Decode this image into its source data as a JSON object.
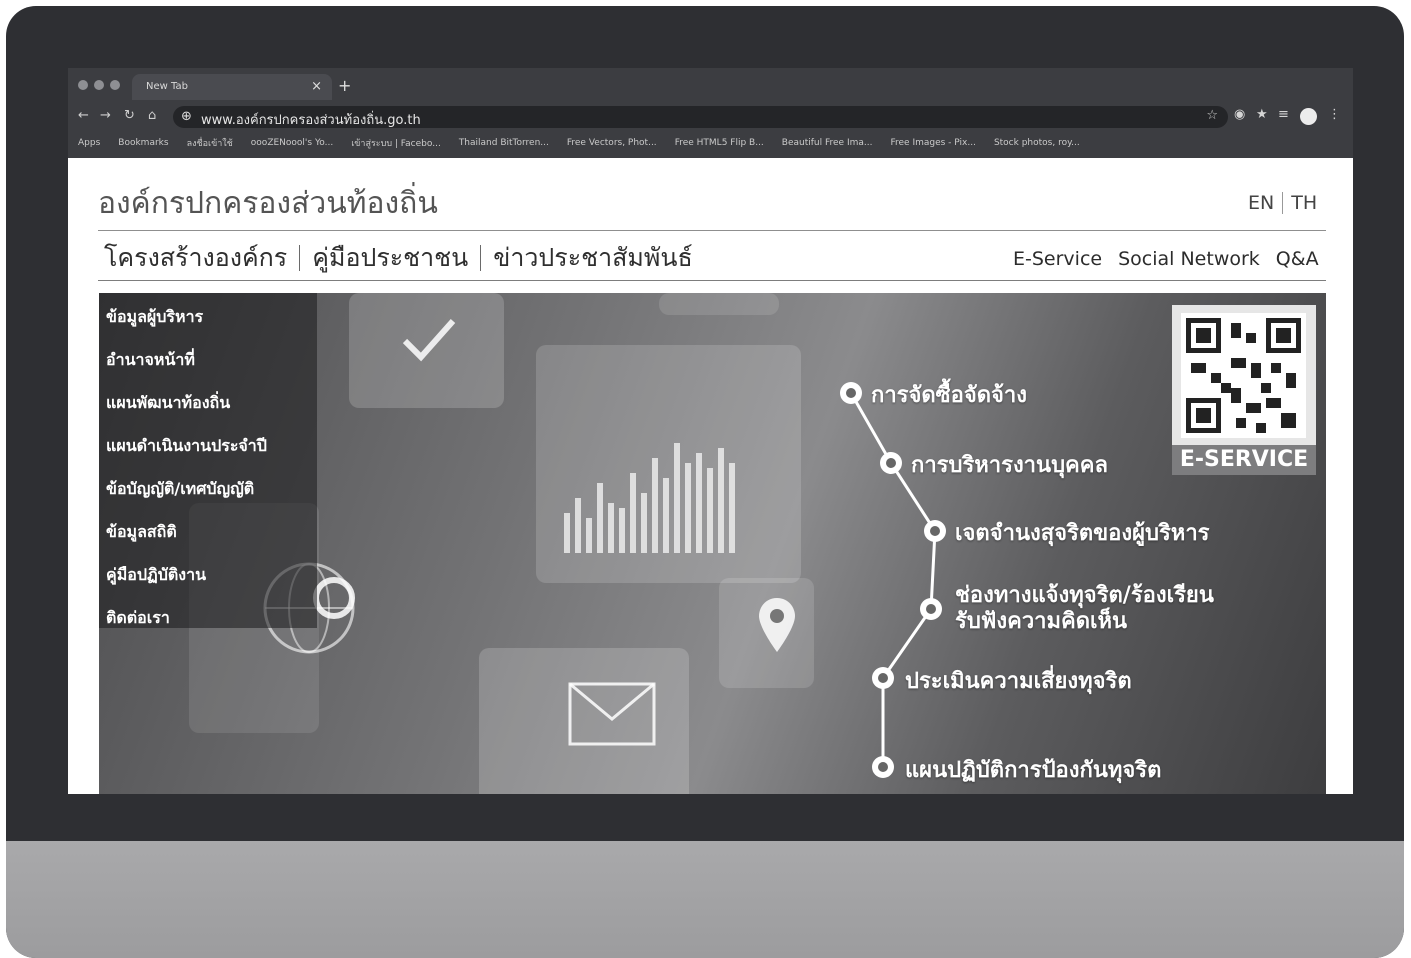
{
  "browser": {
    "tab_title": "New Tab",
    "tab_close": "×",
    "new_tab": "+",
    "url": "www.องค์กรปกครองส่วนท้องถิ่น.go.th",
    "bookmarks": [
      "Apps",
      "Bookmarks",
      "ลงชื่อเข้าใช้",
      "oooZENoool's Yo...",
      "เข้าสู่ระบบ | Facebo...",
      "Thailand BitTorren...",
      "Free Vectors, Phot...",
      "Free HTML5 Flip B...",
      "Beautiful Free Ima...",
      "Free Images - Pix...",
      "Stock photos, roy..."
    ]
  },
  "site": {
    "title": "องค์กรปกครองส่วนท้องถิ่น",
    "lang_en": "EN",
    "lang_th": "TH"
  },
  "main_nav": [
    "โครงสร้างองค์กร",
    "คู่มือประชาชน",
    "ข่าวประชาสัมพันธ์"
  ],
  "sub_nav": [
    "E-Service",
    "Social Network",
    "Q&A"
  ],
  "side_menu": [
    "ข้อมูลผู้บริหาร",
    "อำนาจหน้าที่",
    "แผนพัฒนาท้องถิ่น",
    "แผนดำเนินงานประจำปี",
    "ข้อบัญญัติ/เทศบัญญัติ",
    "ข้อมูลสถิติ",
    "คู่มือปฏิบัติงาน",
    "ติดต่อเรา"
  ],
  "timeline": [
    "การจัดซื้อจัดจ้าง",
    "การบริหารงานบุคคล",
    "เจตจำนงสุจริตของผู้บริหาร",
    "ช่องทางแจ้งทุจริต/ร้องเรียน\nรับฟังความคิดเห็น",
    "ประเมินความเสี่ยงทุจริต",
    "แผนปฏิบัติการป้องกันทุจริต"
  ],
  "qr": {
    "label": "E-SERVICE"
  },
  "colors": {
    "hero_dark": "#3d3d3f",
    "accent_white": "#ffffff"
  }
}
